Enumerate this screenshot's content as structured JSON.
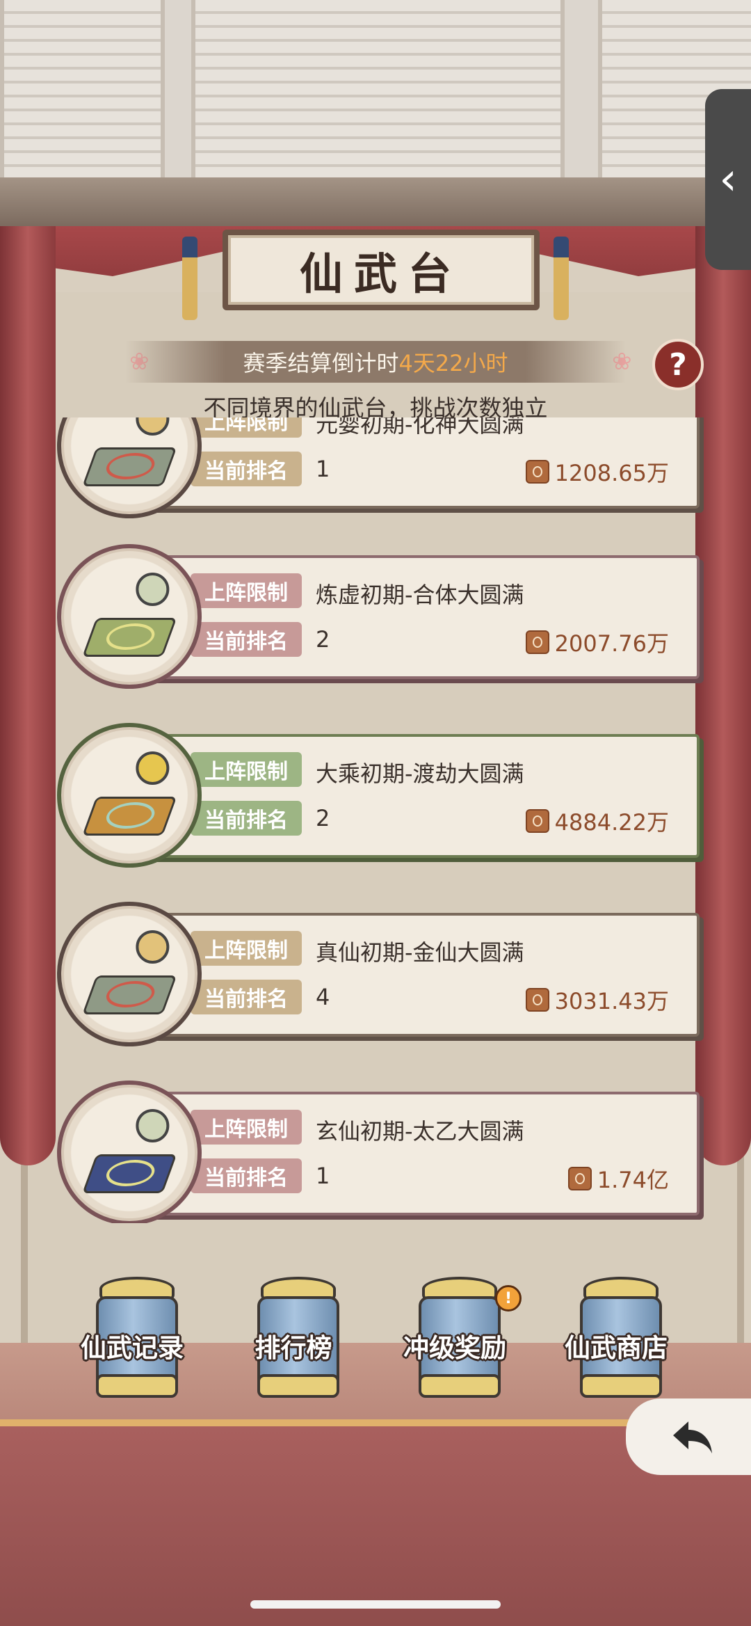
{
  "header": {
    "title": "仙武台"
  },
  "timer": {
    "label": "赛季结算倒计时",
    "value": "4天22小时"
  },
  "subtitle": "不同境界的仙武台，挑战次数独立",
  "cards": [
    {
      "limit_label": "上阵限制",
      "limit_value": "元婴初期-化神大圆满",
      "rank_label": "当前排名",
      "rank_value": "1",
      "score": "1208.65万",
      "theme": "neutral"
    },
    {
      "limit_label": "上阵限制",
      "limit_value": "炼虚初期-合体大圆满",
      "rank_label": "当前排名",
      "rank_value": "2",
      "score": "2007.76万",
      "theme": "rose"
    },
    {
      "limit_label": "上阵限制",
      "limit_value": "大乘初期-渡劫大圆满",
      "rank_label": "当前排名",
      "rank_value": "2",
      "score": "4884.22万",
      "theme": "green"
    },
    {
      "limit_label": "上阵限制",
      "limit_value": "真仙初期-金仙大圆满",
      "rank_label": "当前排名",
      "rank_value": "4",
      "score": "3031.43万",
      "theme": "neutral"
    },
    {
      "limit_label": "上阵限制",
      "limit_value": "玄仙初期-太乙大圆满",
      "rank_label": "当前排名",
      "rank_value": "1",
      "score": "1.74亿",
      "theme": "rose"
    }
  ],
  "bottom_nav": [
    {
      "label": "仙武记录",
      "alert": false
    },
    {
      "label": "排行榜",
      "alert": false
    },
    {
      "label": "冲级奖励",
      "alert": true
    },
    {
      "label": "仙武商店",
      "alert": false
    }
  ],
  "icons": {
    "help": "?",
    "side_tab": "‹",
    "alert": "!"
  },
  "colors": {
    "accent": "#f4a94a",
    "help": "#8a2f2a"
  }
}
